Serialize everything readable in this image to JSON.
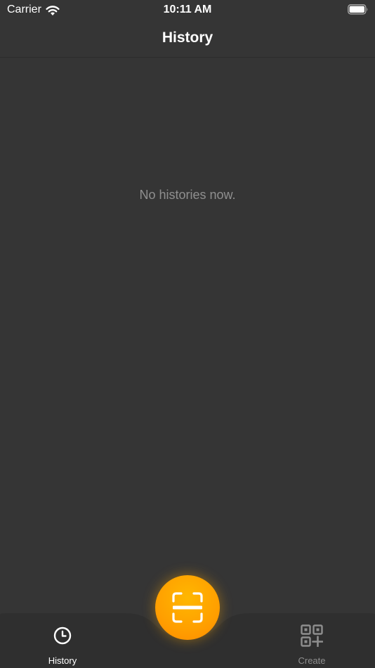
{
  "status_bar": {
    "carrier": "Carrier",
    "time": "10:11 AM",
    "icons": [
      "wifi-icon",
      "battery-icon"
    ]
  },
  "nav": {
    "title": "History"
  },
  "empty_state": {
    "message": "No histories now."
  },
  "tab_bar": {
    "tabs": [
      {
        "label": "History",
        "icon": "clock-icon",
        "selected": true
      },
      {
        "label": "Create",
        "icon": "qr-code-plus-icon",
        "selected": false
      }
    ],
    "scan_button": {
      "icon": "scan-icon"
    }
  },
  "colors": {
    "background": "#353535",
    "accent": "#FFA200",
    "muted_text": "#8F8F8F",
    "tab_bar_background": "#2F2F2F"
  }
}
